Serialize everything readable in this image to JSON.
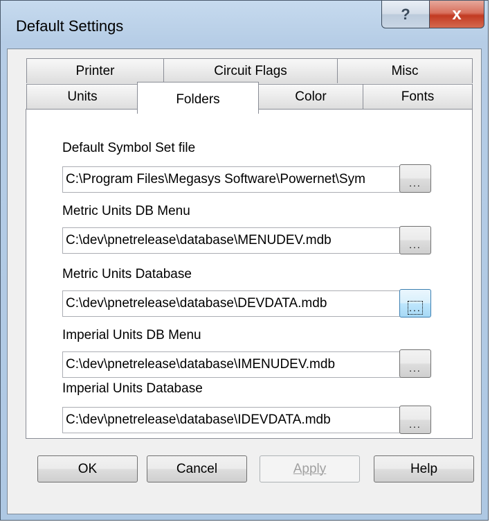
{
  "window": {
    "title": "Default Settings",
    "help_label": "?",
    "close_label": "x"
  },
  "tabs": {
    "row1": [
      "Printer",
      "Circuit Flags",
      "Misc"
    ],
    "row2": [
      "Units",
      "Folders",
      "Color",
      "Fonts"
    ],
    "selected": "Folders"
  },
  "folders": [
    {
      "label": "Default Symbol Set file",
      "value": "C:\\Program Files\\Megasys Software\\Powernet\\Sym"
    },
    {
      "label": "Metric Units DB Menu",
      "value": "C:\\dev\\pnetrelease\\database\\MENUDEV.mdb"
    },
    {
      "label": "Metric Units Database",
      "value": "C:\\dev\\pnetrelease\\database\\DEVDATA.mdb"
    },
    {
      "label": "Imperial Units DB Menu",
      "value": "C:\\dev\\pnetrelease\\database\\IMENUDEV.mdb"
    },
    {
      "label": "Imperial Units Database",
      "value": "C:\\dev\\pnetrelease\\database\\IDEVDATA.mdb"
    }
  ],
  "browse_label": "...",
  "buttons": {
    "ok": "OK",
    "cancel": "Cancel",
    "apply": "Apply",
    "help": "Help"
  }
}
